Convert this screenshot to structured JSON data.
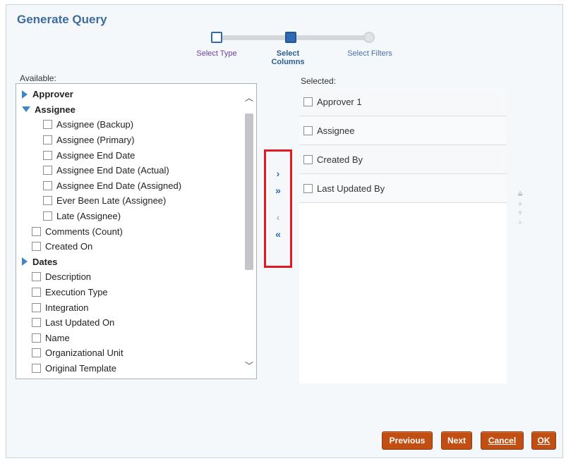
{
  "dialog": {
    "title": "Generate Query"
  },
  "train": {
    "steps": [
      {
        "label": "Select Type",
        "state": "visited"
      },
      {
        "label": "Select Columns",
        "state": "current"
      },
      {
        "label": "Select Filters",
        "state": "future"
      }
    ]
  },
  "available": {
    "label": "Available:",
    "items": [
      {
        "label": "Approver",
        "kind": "group-collapsed"
      },
      {
        "label": "Assignee",
        "kind": "group-expanded"
      },
      {
        "label": "Assignee (Backup)",
        "kind": "child"
      },
      {
        "label": "Assignee (Primary)",
        "kind": "child"
      },
      {
        "label": "Assignee End Date",
        "kind": "child"
      },
      {
        "label": "Assignee End Date (Actual)",
        "kind": "child"
      },
      {
        "label": "Assignee End Date (Assigned)",
        "kind": "child"
      },
      {
        "label": "Ever Been Late (Assignee)",
        "kind": "child"
      },
      {
        "label": "Late (Assignee)",
        "kind": "child"
      },
      {
        "label": "Comments (Count)",
        "kind": "item"
      },
      {
        "label": "Created On",
        "kind": "item"
      },
      {
        "label": "Dates",
        "kind": "group-collapsed"
      },
      {
        "label": "Description",
        "kind": "item"
      },
      {
        "label": "Execution Type",
        "kind": "item"
      },
      {
        "label": "Integration",
        "kind": "item"
      },
      {
        "label": "Last Updated On",
        "kind": "item"
      },
      {
        "label": "Name",
        "kind": "item"
      },
      {
        "label": "Organizational Unit",
        "kind": "item"
      },
      {
        "label": "Original Template",
        "kind": "item"
      }
    ]
  },
  "shuttle": {
    "move": "›",
    "move_all": "»",
    "remove": "‹",
    "remove_all": "«"
  },
  "selected": {
    "label": "Selected:",
    "items": [
      "Approver 1",
      "Assignee",
      "Created By",
      "Last Updated By"
    ]
  },
  "reorder": {
    "top": "⩠",
    "up": "▵",
    "down": "▿",
    "bottom": "⩡"
  },
  "buttons": {
    "previous": "Previous",
    "next": "Next",
    "cancel": "Cancel",
    "ok": "OK"
  },
  "colors": {
    "accent": "#2d6ab0",
    "button": "#c14f13",
    "highlight": "#e01b24"
  }
}
